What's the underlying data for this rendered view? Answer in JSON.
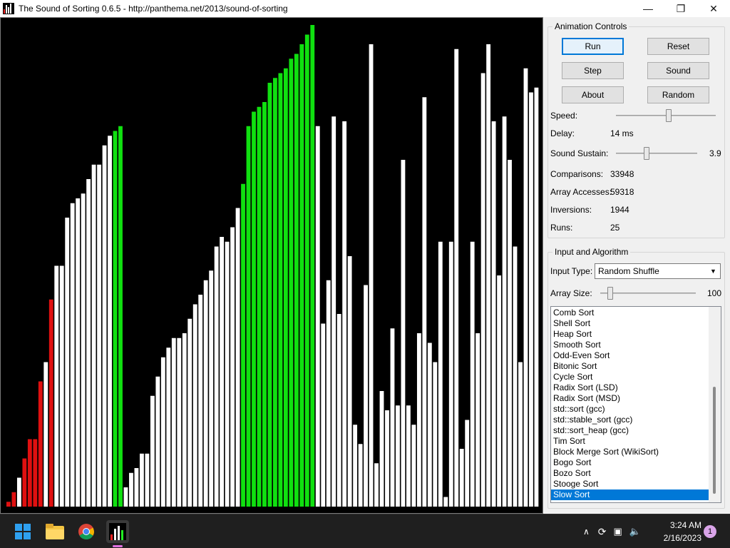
{
  "window": {
    "title": "The Sound of Sorting 0.6.5 - http://panthema.net/2013/sound-of-sorting",
    "minimize": "—",
    "maximize": "❐",
    "close": "✕"
  },
  "visualization": {
    "colors": {
      "sorted": "#ffffff",
      "compare": "#e01010",
      "access": "#10e010"
    },
    "bars": [
      {
        "v": 1,
        "c": "red"
      },
      {
        "v": 3,
        "c": "red"
      },
      {
        "v": 6,
        "c": "white"
      },
      {
        "v": 10,
        "c": "red"
      },
      {
        "v": 14,
        "c": "red"
      },
      {
        "v": 14,
        "c": "red"
      },
      {
        "v": 26,
        "c": "red"
      },
      {
        "v": 30,
        "c": "white"
      },
      {
        "v": 43,
        "c": "red"
      },
      {
        "v": 50,
        "c": "white"
      },
      {
        "v": 50,
        "c": "white"
      },
      {
        "v": 60,
        "c": "white"
      },
      {
        "v": 63,
        "c": "white"
      },
      {
        "v": 64,
        "c": "white"
      },
      {
        "v": 65,
        "c": "white"
      },
      {
        "v": 68,
        "c": "white"
      },
      {
        "v": 71,
        "c": "white"
      },
      {
        "v": 71,
        "c": "white"
      },
      {
        "v": 75,
        "c": "white"
      },
      {
        "v": 77,
        "c": "white"
      },
      {
        "v": 78,
        "c": "green"
      },
      {
        "v": 79,
        "c": "green"
      },
      {
        "v": 4,
        "c": "white"
      },
      {
        "v": 7,
        "c": "white"
      },
      {
        "v": 8,
        "c": "white"
      },
      {
        "v": 11,
        "c": "white"
      },
      {
        "v": 11,
        "c": "white"
      },
      {
        "v": 23,
        "c": "white"
      },
      {
        "v": 27,
        "c": "white"
      },
      {
        "v": 31,
        "c": "white"
      },
      {
        "v": 33,
        "c": "white"
      },
      {
        "v": 35,
        "c": "white"
      },
      {
        "v": 35,
        "c": "white"
      },
      {
        "v": 36,
        "c": "white"
      },
      {
        "v": 39,
        "c": "white"
      },
      {
        "v": 42,
        "c": "white"
      },
      {
        "v": 44,
        "c": "white"
      },
      {
        "v": 47,
        "c": "white"
      },
      {
        "v": 49,
        "c": "white"
      },
      {
        "v": 54,
        "c": "white"
      },
      {
        "v": 56,
        "c": "white"
      },
      {
        "v": 55,
        "c": "white"
      },
      {
        "v": 58,
        "c": "white"
      },
      {
        "v": 62,
        "c": "white"
      },
      {
        "v": 67,
        "c": "green"
      },
      {
        "v": 79,
        "c": "green"
      },
      {
        "v": 82,
        "c": "green"
      },
      {
        "v": 83,
        "c": "green"
      },
      {
        "v": 84,
        "c": "green"
      },
      {
        "v": 88,
        "c": "green"
      },
      {
        "v": 89,
        "c": "green"
      },
      {
        "v": 90,
        "c": "green"
      },
      {
        "v": 91,
        "c": "green"
      },
      {
        "v": 93,
        "c": "green"
      },
      {
        "v": 94,
        "c": "green"
      },
      {
        "v": 96,
        "c": "green"
      },
      {
        "v": 98,
        "c": "green"
      },
      {
        "v": 100,
        "c": "green"
      },
      {
        "v": 79,
        "c": "white"
      },
      {
        "v": 38,
        "c": "white"
      },
      {
        "v": 47,
        "c": "white"
      },
      {
        "v": 81,
        "c": "white"
      },
      {
        "v": 40,
        "c": "white"
      },
      {
        "v": 80,
        "c": "white"
      },
      {
        "v": 52,
        "c": "white"
      },
      {
        "v": 17,
        "c": "white"
      },
      {
        "v": 13,
        "c": "white"
      },
      {
        "v": 46,
        "c": "white"
      },
      {
        "v": 96,
        "c": "white"
      },
      {
        "v": 9,
        "c": "white"
      },
      {
        "v": 24,
        "c": "white"
      },
      {
        "v": 20,
        "c": "white"
      },
      {
        "v": 37,
        "c": "white"
      },
      {
        "v": 21,
        "c": "white"
      },
      {
        "v": 72,
        "c": "white"
      },
      {
        "v": 21,
        "c": "white"
      },
      {
        "v": 17,
        "c": "white"
      },
      {
        "v": 36,
        "c": "white"
      },
      {
        "v": 85,
        "c": "white"
      },
      {
        "v": 34,
        "c": "white"
      },
      {
        "v": 30,
        "c": "white"
      },
      {
        "v": 55,
        "c": "white"
      },
      {
        "v": 2,
        "c": "white"
      },
      {
        "v": 55,
        "c": "white"
      },
      {
        "v": 95,
        "c": "white"
      },
      {
        "v": 12,
        "c": "white"
      },
      {
        "v": 18,
        "c": "white"
      },
      {
        "v": 55,
        "c": "white"
      },
      {
        "v": 36,
        "c": "white"
      },
      {
        "v": 90,
        "c": "white"
      },
      {
        "v": 96,
        "c": "white"
      },
      {
        "v": 80,
        "c": "white"
      },
      {
        "v": 48,
        "c": "white"
      },
      {
        "v": 81,
        "c": "white"
      },
      {
        "v": 72,
        "c": "white"
      },
      {
        "v": 54,
        "c": "white"
      },
      {
        "v": 30,
        "c": "white"
      },
      {
        "v": 91,
        "c": "white"
      },
      {
        "v": 86,
        "c": "white"
      },
      {
        "v": 87,
        "c": "white"
      }
    ]
  },
  "animation": {
    "group_title": "Animation Controls",
    "buttons": {
      "run": "Run",
      "reset": "Reset",
      "step": "Step",
      "sound": "Sound",
      "about": "About",
      "random": "Random"
    },
    "speed_label": "Speed:",
    "speed_level": 0.53,
    "delay_label": "Delay:",
    "delay_value": "14 ms",
    "sustain_label": "Sound Sustain:",
    "sustain_value": "3.9",
    "sustain_level": 0.37,
    "comparisons_label": "Comparisons:",
    "comparisons_value": "33948",
    "accesses_label": "Array Accesses:",
    "accesses_value": "59318",
    "inversions_label": "Inversions:",
    "inversions_value": "1944",
    "runs_label": "Runs:",
    "runs_value": "25"
  },
  "input": {
    "group_title": "Input and Algorithm",
    "input_type_label": "Input Type:",
    "input_type_value": "Random Shuffle",
    "array_size_label": "Array Size:",
    "array_size_value": "100",
    "array_size_level": 0.08,
    "algorithms": [
      "Comb Sort",
      "Shell Sort",
      "Heap Sort",
      "Smooth Sort",
      "Odd-Even Sort",
      "Bitonic Sort",
      "Cycle Sort",
      "Radix Sort (LSD)",
      "Radix Sort (MSD)",
      "std::sort (gcc)",
      "std::stable_sort (gcc)",
      "std::sort_heap (gcc)",
      "Tim Sort",
      "Block Merge Sort (WikiSort)",
      "Bogo Sort",
      "Bozo Sort",
      "Stooge Sort",
      "Slow Sort"
    ],
    "selected_algorithm": "Slow Sort"
  },
  "taskbar": {
    "time": "3:24 AM",
    "date": "2/16/2023",
    "notification_count": "1",
    "icons": [
      "windows-start-icon",
      "file-explorer-icon",
      "chrome-icon",
      "sound-of-sorting-icon"
    ]
  }
}
